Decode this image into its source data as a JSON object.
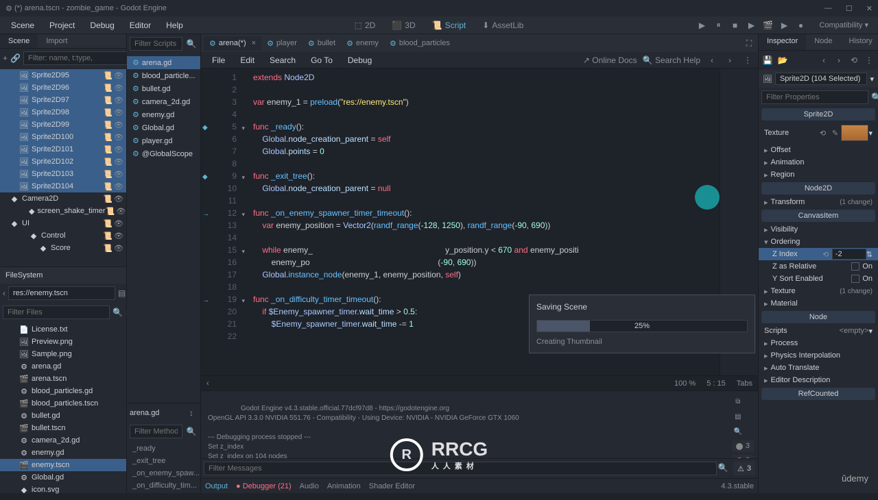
{
  "titlebar": {
    "text": "(*) arena.tscn - zombie_game - Godot Engine"
  },
  "menubar": {
    "items": [
      "Scene",
      "Project",
      "Debug",
      "Editor",
      "Help"
    ],
    "views": {
      "d2": "2D",
      "d3": "3D",
      "script": "Script",
      "assetlib": "AssetLib"
    },
    "compat": "Compatibility"
  },
  "scene_panel": {
    "tabs": [
      "Scene",
      "Import"
    ],
    "filter_placeholder": "Filter: name, t:type,",
    "nodes": [
      {
        "name": "Sprite2D95",
        "selected": true
      },
      {
        "name": "Sprite2D96",
        "selected": true
      },
      {
        "name": "Sprite2D97",
        "selected": true
      },
      {
        "name": "Sprite2D98",
        "selected": true
      },
      {
        "name": "Sprite2D99",
        "selected": true
      },
      {
        "name": "Sprite2D100",
        "selected": true
      },
      {
        "name": "Sprite2D101",
        "selected": true
      },
      {
        "name": "Sprite2D102",
        "selected": true
      },
      {
        "name": "Sprite2D103",
        "selected": true
      },
      {
        "name": "Sprite2D104",
        "selected": true
      },
      {
        "name": "Camera2D",
        "indent": 0,
        "icon": "camera"
      },
      {
        "name": "screen_shake_timer",
        "indent": 1,
        "icon": "timer"
      },
      {
        "name": "UI",
        "indent": 0,
        "icon": "canvas"
      },
      {
        "name": "Control",
        "indent": 1,
        "icon": "control"
      },
      {
        "name": "Score",
        "indent": 2,
        "icon": "label"
      }
    ]
  },
  "filesystem": {
    "header": "FileSystem",
    "path": "res://enemy.tscn",
    "filter_placeholder": "Filter Files",
    "items": [
      {
        "name": "License.txt",
        "icon": "txt"
      },
      {
        "name": "Preview.png",
        "icon": "img"
      },
      {
        "name": "Sample.png",
        "icon": "img"
      },
      {
        "name": "arena.gd",
        "icon": "gd"
      },
      {
        "name": "arena.tscn",
        "icon": "tscn"
      },
      {
        "name": "blood_particles.gd",
        "icon": "gd"
      },
      {
        "name": "blood_particles.tscn",
        "icon": "tscn"
      },
      {
        "name": "bullet.gd",
        "icon": "gd"
      },
      {
        "name": "bullet.tscn",
        "icon": "tscn"
      },
      {
        "name": "camera_2d.gd",
        "icon": "gd"
      },
      {
        "name": "enemy.gd",
        "icon": "gd"
      },
      {
        "name": "enemy.tscn",
        "icon": "tscn",
        "selected": true
      },
      {
        "name": "Global.gd",
        "icon": "gd"
      },
      {
        "name": "icon.svg",
        "icon": "svg"
      }
    ]
  },
  "script_tabs": [
    {
      "label": "arena(*)",
      "active": true,
      "close": true
    },
    {
      "label": "player"
    },
    {
      "label": "bullet"
    },
    {
      "label": "enemy"
    },
    {
      "label": "blood_particles"
    }
  ],
  "editor_menu": {
    "items": [
      "File",
      "Edit",
      "Search",
      "Go To",
      "Debug"
    ],
    "online_docs": "Online Docs",
    "search_help": "Search Help"
  },
  "scripts_panel": {
    "filter_placeholder": "Filter Scripts",
    "scripts": [
      {
        "name": "arena.gd",
        "active": true
      },
      {
        "name": "blood_particle..."
      },
      {
        "name": "bullet.gd"
      },
      {
        "name": "camera_2d.gd"
      },
      {
        "name": "enemy.gd"
      },
      {
        "name": "Global.gd"
      },
      {
        "name": "player.gd"
      },
      {
        "name": "@GlobalScope"
      }
    ],
    "current_script": "arena.gd",
    "filter_methods_placeholder": "Filter Methods",
    "methods": [
      "_ready",
      "_exit_tree",
      "_on_enemy_spaw...",
      "_on_difficulty_tim..."
    ]
  },
  "code": {
    "lines": [
      {
        "n": 1,
        "html": "<span class='kw'>extends</span> <span class='sym'>Node2D</span>"
      },
      {
        "n": 2,
        "html": ""
      },
      {
        "n": 3,
        "html": "<span class='kw'>var</span> <span class='ident'>enemy_1</span> = <span class='fn'>preload</span>(<span class='str'>\"res://enemy.tscn\"</span>)"
      },
      {
        "n": 4,
        "html": ""
      },
      {
        "n": 5,
        "html": "<span class='kw'>func</span> <span class='fn'>_ready</span>():",
        "fold": true,
        "marker": true
      },
      {
        "n": 6,
        "html": "    <span class='sym'>Global</span>.<span class='member'>node_creation_parent</span> = <span class='kw'>self</span>"
      },
      {
        "n": 7,
        "html": "    <span class='sym'>Global</span>.<span class='member'>points</span> = <span class='num'>0</span>"
      },
      {
        "n": 8,
        "html": ""
      },
      {
        "n": 9,
        "html": "<span class='kw'>func</span> <span class='fn'>_exit_tree</span>():",
        "fold": true,
        "marker": true
      },
      {
        "n": 10,
        "html": "    <span class='sym'>Global</span>.<span class='member'>node_creation_parent</span> = <span class='kw'>null</span>"
      },
      {
        "n": 11,
        "html": ""
      },
      {
        "n": 12,
        "html": "<span class='kw'>func</span> <span class='fn'>_on_enemy_spawner_timer_timeout</span>():",
        "fold": true,
        "marker": "arrow"
      },
      {
        "n": 13,
        "html": "    <span class='kw'>var</span> <span class='ident'>enemy_position</span> = <span class='sym'>Vector2</span>(<span class='fn'>randf_range</span>(<span class='num'>-128</span>, <span class='num'>1250</span>), <span class='fn'>randf_range</span>(<span class='num'>-90</span>, <span class='num'>690</span>))"
      },
      {
        "n": 14,
        "html": ""
      },
      {
        "n": 15,
        "html": "    <span class='kw'>while</span> <span class='ident'>enemy_</span>                                                          <span class='ident'>y_position.y</span> &lt; <span class='num'>670</span> <span class='kw'>and</span> <span class='ident'>enemy_positi</span>",
        "fold": true
      },
      {
        "n": 16,
        "html": "        <span class='ident'>enemy_po</span>                                                        (<span class='num'>-90</span>, <span class='num'>690</span>))"
      },
      {
        "n": 17,
        "html": "    <span class='sym'>Global</span>.<span class='fn'>instance_node</span>(<span class='ident'>enemy_1</span>, <span class='ident'>enemy_position</span>, <span class='kw'>self</span>)"
      },
      {
        "n": 18,
        "html": ""
      },
      {
        "n": 19,
        "html": "<span class='kw'>func</span> <span class='fn'>_on_difficulty_timer_timeout</span>():",
        "fold": true,
        "marker": "arrow"
      },
      {
        "n": 20,
        "html": "    <span class='kw'>if</span> <span class='sym'>$Enemy_spawner_timer</span>.<span class='member'>wait_time</span> &gt; <span class='num'>0.5</span>:"
      },
      {
        "n": 21,
        "html": "        <span class='sym'>$Enemy_spawner_timer</span>.<span class='member'>wait_time</span> -= <span class='num'>1</span>"
      },
      {
        "n": 22,
        "html": ""
      }
    ]
  },
  "modal": {
    "title": "Saving Scene",
    "percent": "25%",
    "status": "Creating Thumbnail"
  },
  "status_bar": {
    "zoom": "100 %",
    "cursor": "5 : 15",
    "indent": "Tabs"
  },
  "output": {
    "lines": "Godot Engine v4.3.stable.official.77dcf97d8 - https://godotengine.org\nOpenGL API 3.3.0 NVIDIA 551.76 - Compatibility - Using Device: NVIDIA - NVIDIA GeForce GTX 1060\n\n--- Debugging process stopped ---\nSet z_index\nSet z_index on 104 nodes",
    "filter_placeholder": "Filter Messages",
    "badges": {
      "err": "0",
      "warn": "0",
      "info": "3",
      "total": "3"
    },
    "tabs": {
      "output": "Output",
      "debugger": "Debugger (21)",
      "audio": "Audio",
      "animation": "Animation",
      "shader": "Shader Editor"
    },
    "version": "4.3.stable"
  },
  "inspector": {
    "tabs": [
      "Inspector",
      "Node",
      "History"
    ],
    "object": "Sprite2D (104 Selected)",
    "filter_placeholder": "Filter Properties",
    "section_sprite": "Sprite2D",
    "texture_label": "Texture",
    "groups": [
      {
        "label": "Offset"
      },
      {
        "label": "Animation"
      },
      {
        "label": "Region"
      }
    ],
    "section_node2d": "Node2D",
    "transform": {
      "label": "Transform",
      "changes": "(1 change)"
    },
    "section_canvas": "CanvasItem",
    "visibility": "Visibility",
    "ordering": "Ordering",
    "z_index": {
      "label": "Z Index",
      "value": "-2"
    },
    "z_relative": {
      "label": "Z as Relative",
      "value": "On"
    },
    "y_sort": {
      "label": "Y Sort Enabled",
      "value": "On"
    },
    "texture_group": {
      "label": "Texture",
      "changes": "(1 change)"
    },
    "material": "Material",
    "section_node": "Node",
    "scripts": {
      "label": "Scripts",
      "value": "<empty>"
    },
    "more_groups": [
      "Process",
      "Physics Interpolation",
      "Auto Translate",
      "Editor Description"
    ],
    "section_ref": "RefCounted"
  },
  "watermark": {
    "main": "RRCG",
    "sub": "人人素材"
  },
  "udemy": "ûdemy"
}
